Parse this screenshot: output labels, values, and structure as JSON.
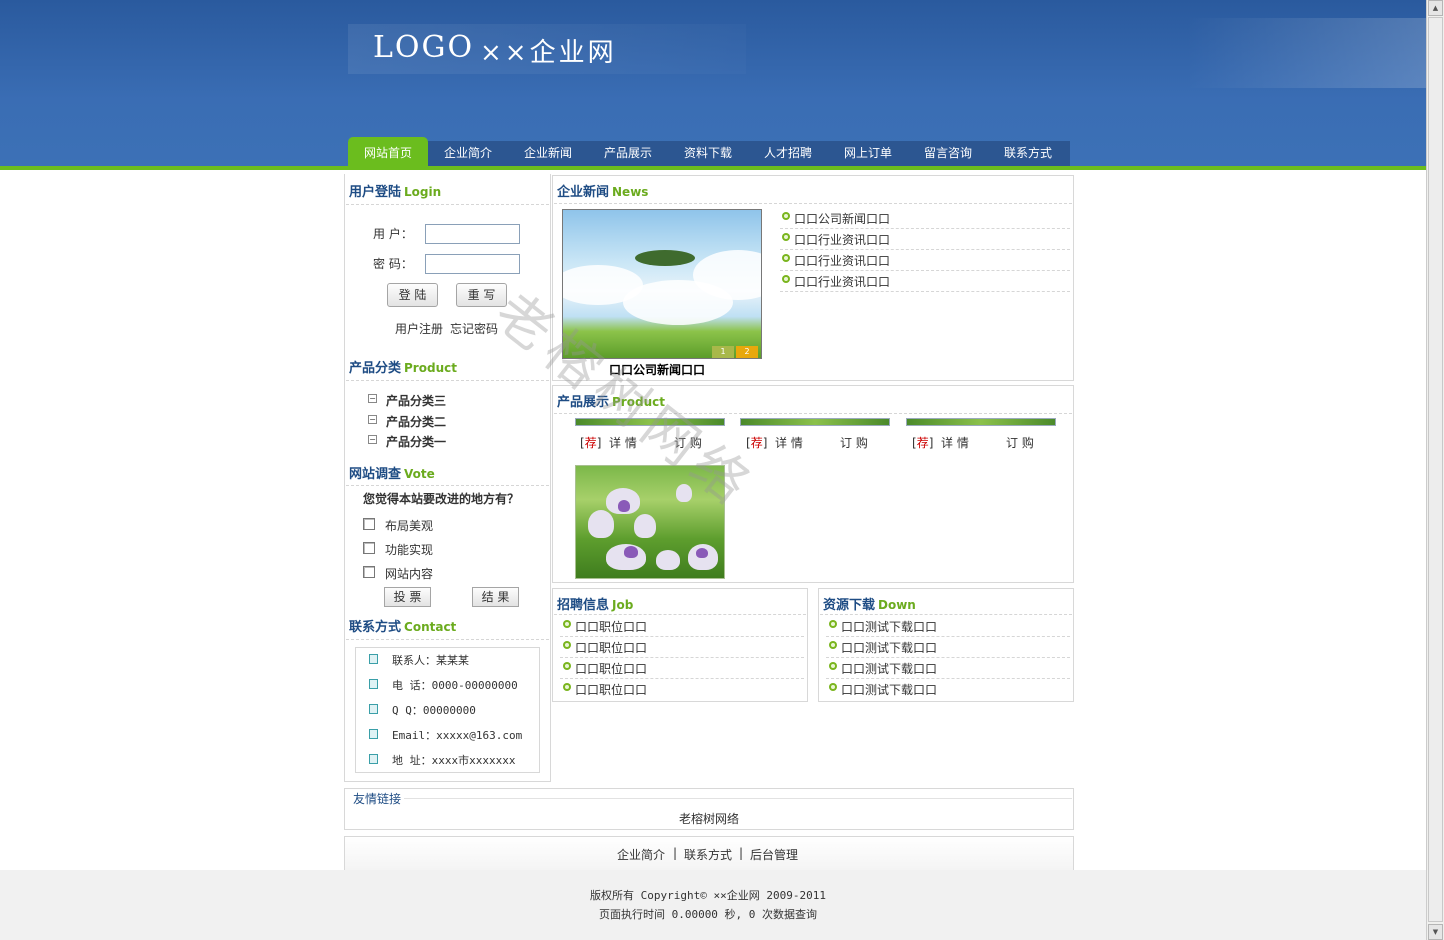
{
  "header": {
    "logo": "LOGO",
    "site_name": "××企业网"
  },
  "nav": [
    {
      "label": "网站首页",
      "active": true
    },
    {
      "label": "企业简介"
    },
    {
      "label": "企业新闻"
    },
    {
      "label": "产品展示"
    },
    {
      "label": "资料下载"
    },
    {
      "label": "人才招聘"
    },
    {
      "label": "网上订单"
    },
    {
      "label": "留言咨询"
    },
    {
      "label": "联系方式"
    }
  ],
  "login": {
    "title": "用户登陆",
    "title_en": "Login",
    "user_label": "用 户：",
    "pass_label": "密 码：",
    "user_value": "",
    "pass_value": "",
    "login_button": "登 陆",
    "reset_button": "重 写",
    "register_link": "用户注册",
    "forgot_link": "忘记密码"
  },
  "product_categories": {
    "title": "产品分类",
    "title_en": "Product",
    "items": [
      "产品分类三",
      "产品分类二",
      "产品分类一"
    ]
  },
  "vote": {
    "title": "网站调查",
    "title_en": "Vote",
    "question": "您觉得本站要改进的地方有？",
    "options": [
      "布局美观",
      "功能实现",
      "网站内容"
    ],
    "vote_button": "投 票",
    "result_button": "结 果"
  },
  "contact": {
    "title": "联系方式",
    "title_en": "Contact",
    "rows": [
      "联系人：某某某",
      "电 话：0000-00000000",
      "Q Q：00000000",
      "Email：xxxxx@163.com",
      "地 址：xxxx市xxxxxxx"
    ]
  },
  "news": {
    "title": "企业新闻",
    "title_en": "News",
    "caption": "口口公司新闻口口",
    "slider_numbers": [
      "1",
      "2"
    ],
    "items": [
      "口口公司新闻口口",
      "口口行业资讯口口",
      "口口行业资讯口口",
      "口口行业资讯口口"
    ]
  },
  "products": {
    "title": "产品展示",
    "title_en": "Product",
    "recommend_mark": "荐",
    "detail_label": "详 情",
    "order_label": "订 购",
    "bracket_open": "[",
    "bracket_close": "]"
  },
  "jobs": {
    "title": "招聘信息",
    "title_en": "Job",
    "items": [
      "口口职位口口",
      "口口职位口口",
      "口口职位口口",
      "口口职位口口"
    ]
  },
  "downloads": {
    "title": "资源下载",
    "title_en": "Down",
    "items": [
      "口口测试下载口口",
      "口口测试下载口口",
      "口口测试下载口口",
      "口口测试下载口口"
    ]
  },
  "friend_links": {
    "title": "友情链接",
    "items": [
      "老榕树网络"
    ]
  },
  "footer": {
    "links": [
      "企业简介",
      "联系方式",
      "后台管理"
    ],
    "separator": "|",
    "copyright": "版权所有 Copyright© ××企业网 2009-2011",
    "exec_time": "页面执行时间 0.00000 秒, 0 次数据查询"
  },
  "watermark": "老榕树网络",
  "colors": {
    "header_blue": "#3a6db4",
    "nav_blue": "#2c5691",
    "accent_green": "#6bbd1e",
    "title_blue": "#1e4c84",
    "title_green": "#6bab1e"
  }
}
